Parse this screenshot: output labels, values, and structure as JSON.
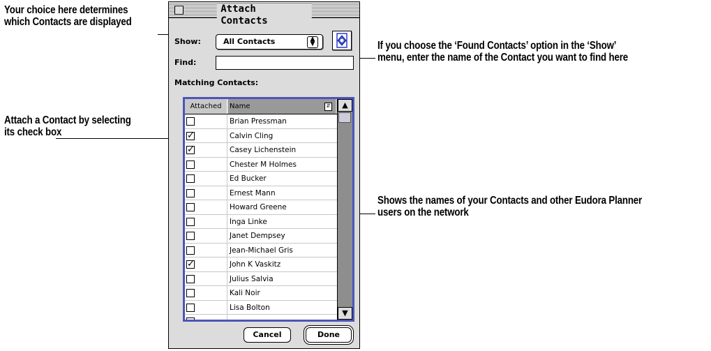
{
  "window": {
    "title": "Attach Contacts"
  },
  "show": {
    "label": "Show:",
    "selected": "All Contacts"
  },
  "find": {
    "label": "Find:",
    "value": ""
  },
  "matching_label": "Matching Contacts:",
  "columns": {
    "attached": "Attached",
    "name": "Name"
  },
  "contacts": [
    {
      "name": "Brian Pressman",
      "attached": false
    },
    {
      "name": "Calvin Cling",
      "attached": true
    },
    {
      "name": "Casey Lichenstein",
      "attached": true
    },
    {
      "name": "Chester M Holmes",
      "attached": false
    },
    {
      "name": "Ed Bucker",
      "attached": false
    },
    {
      "name": "Ernest Mann",
      "attached": false
    },
    {
      "name": "Howard Greene",
      "attached": false
    },
    {
      "name": "Inga Linke",
      "attached": false
    },
    {
      "name": "Janet Dempsey",
      "attached": false
    },
    {
      "name": "Jean-Michael Gris",
      "attached": false
    },
    {
      "name": "John K Vaskitz",
      "attached": true
    },
    {
      "name": "Julius Salvia",
      "attached": false
    },
    {
      "name": "Kali Noir",
      "attached": false
    },
    {
      "name": "Lisa Bolton",
      "attached": false
    }
  ],
  "buttons": {
    "cancel": "Cancel",
    "done": "Done"
  },
  "callouts": {
    "show": [
      "Your choice here determines",
      "which Contacts are displayed"
    ],
    "find": [
      "If you choose the ‘Found Contacts’ option in the ‘Show’",
      "menu, enter the name of the Contact you want to find here"
    ],
    "attach": [
      "Attach a Contact by selecting",
      "its check box"
    ],
    "names": [
      "Shows the names of your Contacts and other Eudora Planner",
      "users on the network"
    ]
  },
  "colors": {
    "list_focus_border": "#4d55b7"
  },
  "icons": {
    "scroll_up": "▲",
    "scroll_down": "▼",
    "check": "✓"
  }
}
